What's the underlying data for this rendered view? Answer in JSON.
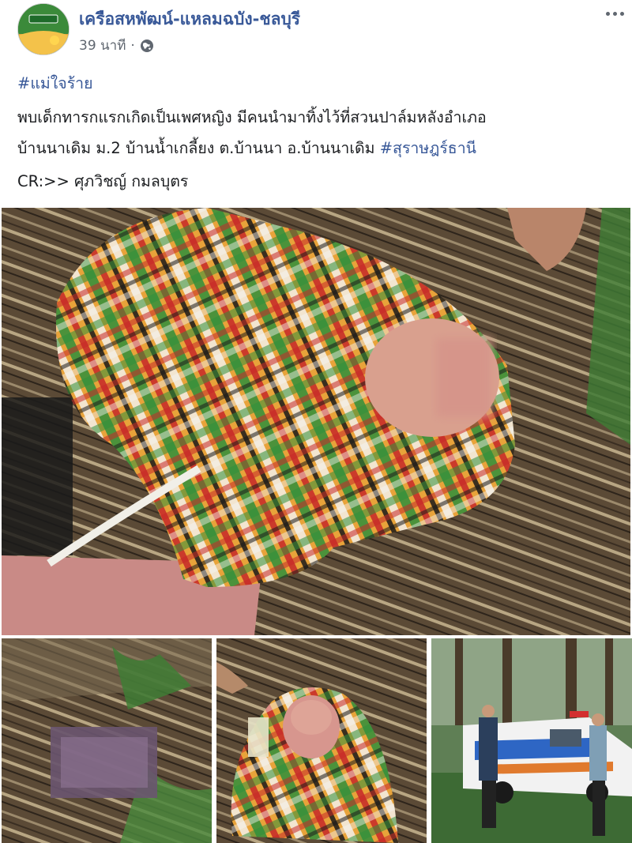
{
  "post": {
    "page_name": "เครือสหพัฒน์-แหลมฉบัง-ชลบุรี",
    "time": "39 นาที",
    "privacy_icon": "globe-icon",
    "menu_icon": "more-options-icon",
    "hashtag1": "#แม่ใจร้าย",
    "body_line1": "พบเด็กทารกแรกเกิดเป็นเพศหญิง มีคนนำมาทิ้งไว้ที่สวนปาล์มหลังอำเภอ",
    "body_line2": "บ้านนาเดิม ม.2 บ้านน้ำเกลี้ยง ต.บ้านนา อ.บ้านนาเดิม ",
    "hashtag2": "#สุราษฎร์ธานี",
    "credit": "CR:>> ศุภวิชญ์ กมลบุตร"
  },
  "colors": {
    "link": "#385898",
    "text": "#1c1e21",
    "secondary": "#606770"
  },
  "photos": [
    {
      "name": "main-photo",
      "subject": "newborn wrapped in plaid cloth on palm fronds"
    },
    {
      "name": "photo-2",
      "subject": "ground with palm fronds, blurred area"
    },
    {
      "name": "photo-3",
      "subject": "newborn wrapped in plaid cloth"
    },
    {
      "name": "photo-4",
      "subject": "rescue pickup truck and workers in plantation"
    }
  ]
}
